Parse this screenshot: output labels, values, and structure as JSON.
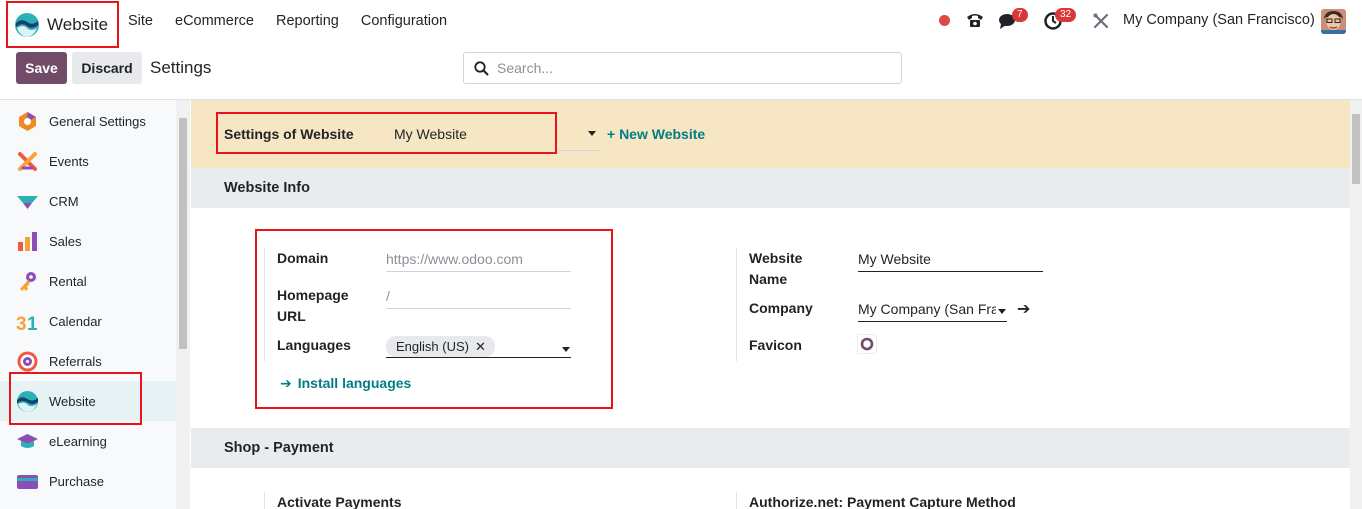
{
  "navbar": {
    "app_name": "Website",
    "menu": [
      "Site",
      "eCommerce",
      "Reporting",
      "Configuration"
    ],
    "messages_count": "7",
    "activities_count": "32",
    "company": "My Company (San Francisco)"
  },
  "control_panel": {
    "save_label": "Save",
    "discard_label": "Discard",
    "title": "Settings",
    "search_placeholder": "Search..."
  },
  "sidebar": {
    "items": [
      {
        "label": "General Settings",
        "icon": "general-settings-icon"
      },
      {
        "label": "Events",
        "icon": "events-icon"
      },
      {
        "label": "CRM",
        "icon": "crm-icon"
      },
      {
        "label": "Sales",
        "icon": "sales-icon"
      },
      {
        "label": "Rental",
        "icon": "rental-icon"
      },
      {
        "label": "Calendar",
        "icon": "calendar-icon"
      },
      {
        "label": "Referrals",
        "icon": "referrals-icon"
      },
      {
        "label": "Website",
        "icon": "website-icon",
        "active": true
      },
      {
        "label": "eLearning",
        "icon": "elearning-icon"
      },
      {
        "label": "Purchase",
        "icon": "purchase-icon"
      }
    ]
  },
  "website_bar": {
    "label": "Settings of Website",
    "value": "My Website",
    "new_website": "+ New Website"
  },
  "website_info": {
    "title": "Website Info",
    "domain_label": "Domain",
    "domain_placeholder": "https://www.odoo.com",
    "homepage_label": "Homepage URL",
    "homepage_placeholder": "/",
    "languages_label": "Languages",
    "language_tag": "English (US)",
    "install_languages": "Install languages",
    "website_name_label": "Website Name",
    "website_name_value": "My Website",
    "company_label": "Company",
    "company_value": "My Company (San Fran",
    "favicon_label": "Favicon"
  },
  "shop_payment": {
    "title": "Shop - Payment",
    "activate_payments": "Activate Payments",
    "authorize_capture": "Authorize.net: Payment Capture Method"
  },
  "colors": {
    "brand": "#714b67",
    "accent": "#017e84",
    "highlight": "#e8141b",
    "website_bar_bg": "#f7e6c4"
  }
}
